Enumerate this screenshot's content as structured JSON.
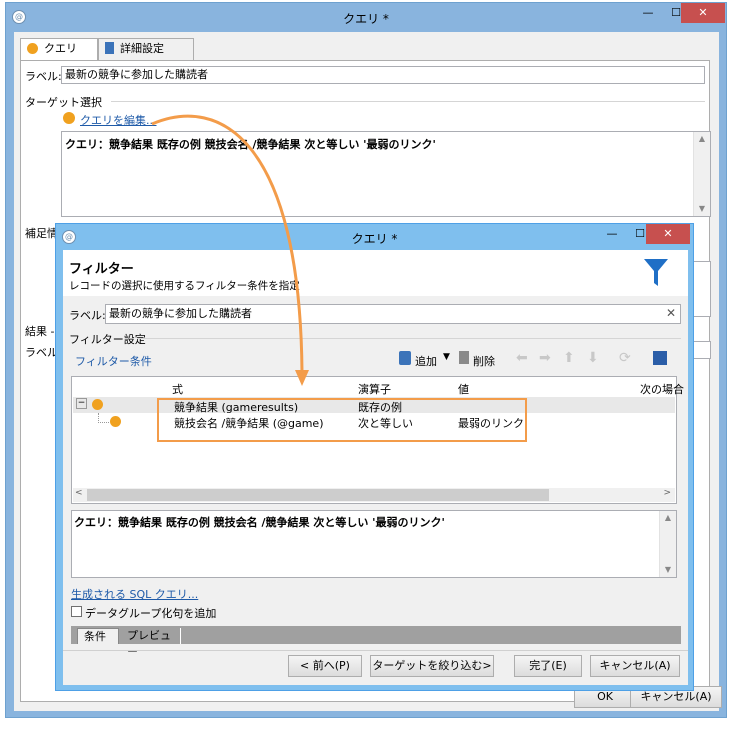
{
  "outer": {
    "title": "クエリ *",
    "tabs": [
      {
        "label": "クエリ"
      },
      {
        "label": "詳細設定"
      }
    ],
    "label_caption": "ラベル:",
    "label_value": "最新の競争に参加した購読者",
    "target_section": "ターゲット選択",
    "edit_query_link": "クエリを編集...",
    "query_text": "クエリ：競争結果 既存の例 競技会名 /競争結果 次と等しい '最弱のリンク'",
    "partial_labels": {
      "hoso": "補足情",
      "result": "結果 -",
      "label2": "ラベル"
    },
    "ok_partial": "OK",
    "cancel_partial": "キャンセル(A)",
    "controls": {
      "minimize": "—",
      "maximize": "☐",
      "close": "✕"
    }
  },
  "inner": {
    "title": "クエリ *",
    "header_title": "フィルター",
    "header_subtitle": "レコードの選択に使用するフィルター条件を指定",
    "label_caption": "ラベル:",
    "label_value": "最新の競争に参加した購読者",
    "filter_settings": "フィルター設定",
    "filter_conditions": "フィルター条件",
    "toolbar": {
      "add": "追加",
      "delete": "削除"
    },
    "columns": [
      "式",
      "演算子",
      "値",
      "次の場合"
    ],
    "rows": [
      {
        "expr": "競争結果 (gameresults)",
        "op": "既存の例",
        "val": ""
      },
      {
        "expr": "競技会名 /競争結果 (@game)",
        "op": "次と等しい",
        "val": "最弱のリンク"
      }
    ],
    "query_text": "クエリ：競争結果 既存の例 競技会名 /競争結果 次と等しい '最弱のリンク'",
    "sql_link": "生成される SQL クエリ...",
    "checkbox_label": "データグループ化句を追加",
    "bottom_tabs": [
      "条件",
      "プレビュー"
    ],
    "buttons": {
      "prev": "< 前へ(P)",
      "narrow": "ターゲットを絞り込む>",
      "finish": "完了(E)",
      "cancel": "キャンセル(A)"
    },
    "controls": {
      "minimize": "—",
      "maximize": "☐",
      "close": "✕"
    }
  },
  "colors": {
    "accent_orange": "#f39c4a",
    "dot_orange": "#f0a11f",
    "filter_blue": "#1f6fc6",
    "link_blue": "#1e5aa8"
  }
}
